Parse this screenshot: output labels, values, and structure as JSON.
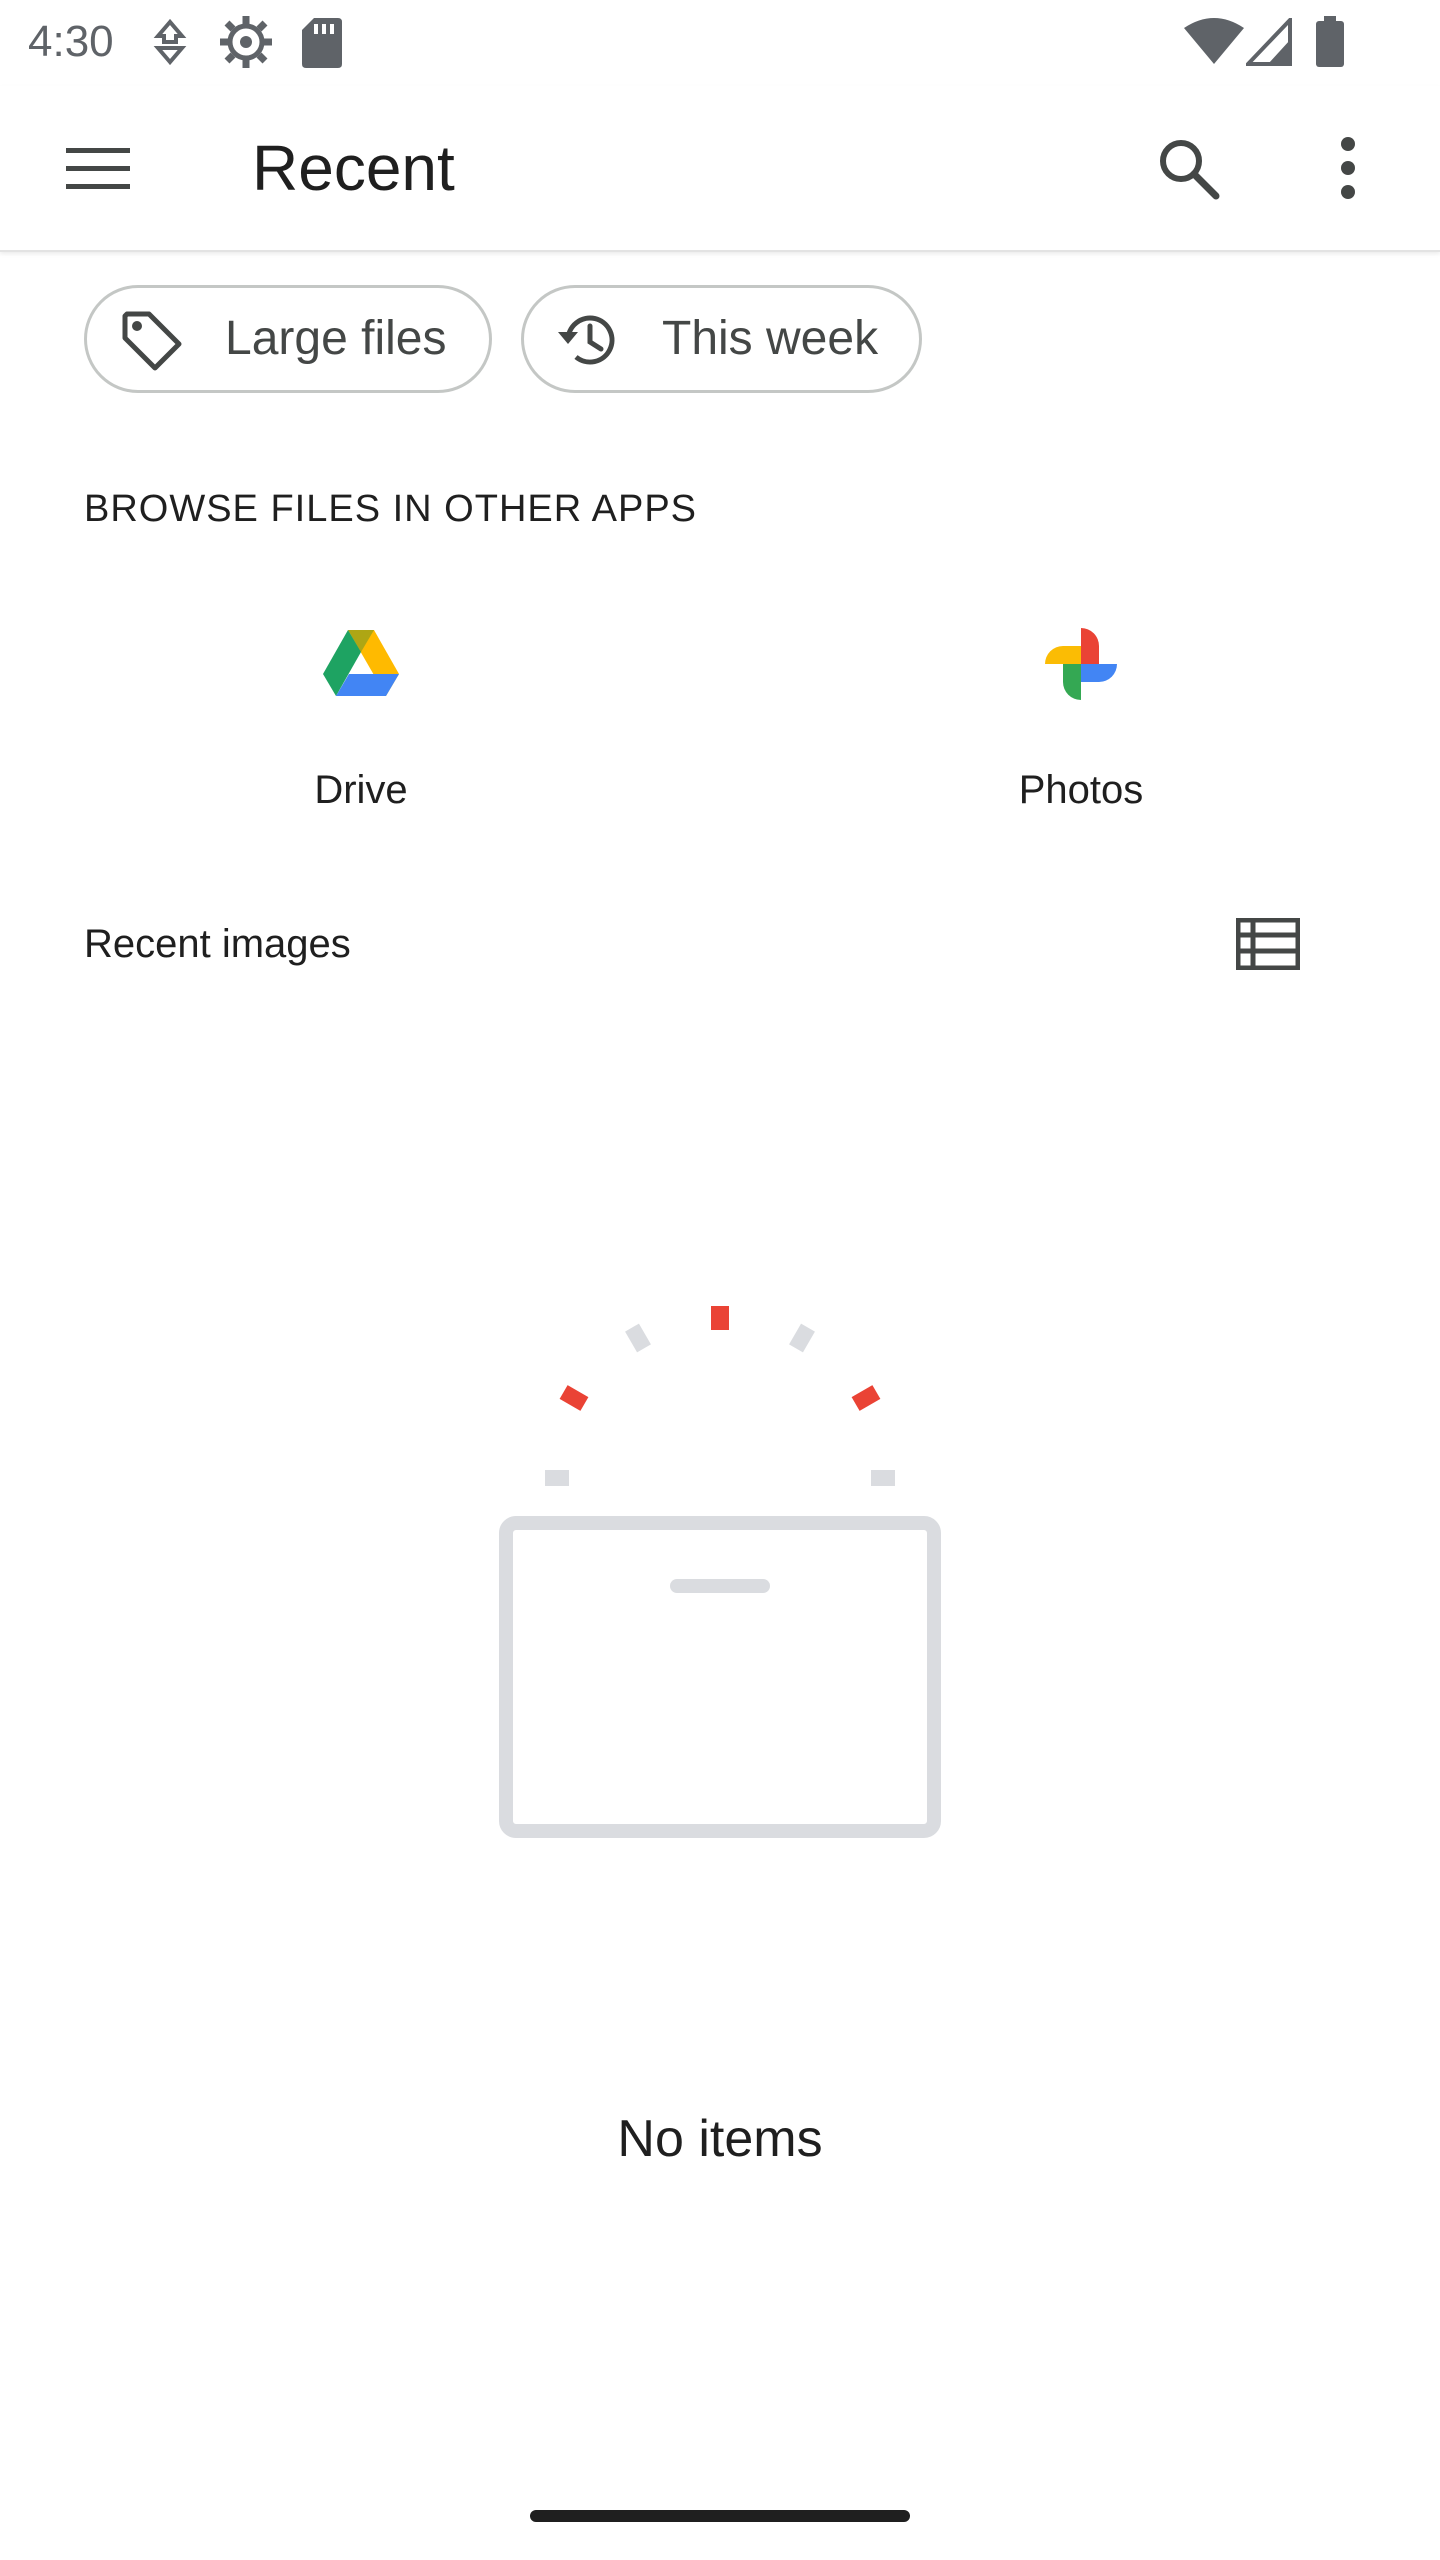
{
  "status_bar": {
    "time": "4:30",
    "icons": [
      "data-saver-icon",
      "settings-gear-icon",
      "sd-card-icon",
      "wifi-icon",
      "cellular-signal-icon",
      "battery-icon"
    ]
  },
  "app_bar": {
    "title": "Recent",
    "menu_icon": "hamburger-menu-icon",
    "search_icon": "search-icon",
    "more_icon": "more-vert-icon"
  },
  "chips": [
    {
      "label": "Large files",
      "icon": "tag-icon"
    },
    {
      "label": "This week",
      "icon": "history-icon"
    }
  ],
  "browse_section": {
    "title": "BROWSE FILES IN OTHER APPS",
    "apps": [
      {
        "label": "Drive",
        "icon": "google-drive-icon"
      },
      {
        "label": "Photos",
        "icon": "google-photos-icon"
      }
    ]
  },
  "recent_images": {
    "title": "Recent images",
    "view_toggle_icon": "list-view-icon"
  },
  "empty_state": {
    "text": "No items"
  },
  "colors": {
    "accent_red": "#ea4335",
    "drive_green": "#1ea362",
    "drive_yellow": "#ffba00",
    "drive_blue": "#4285f4",
    "illustration_gray": "#dadce0",
    "text_primary": "#1f1f1f",
    "chip_border": "#c4c7c5"
  }
}
